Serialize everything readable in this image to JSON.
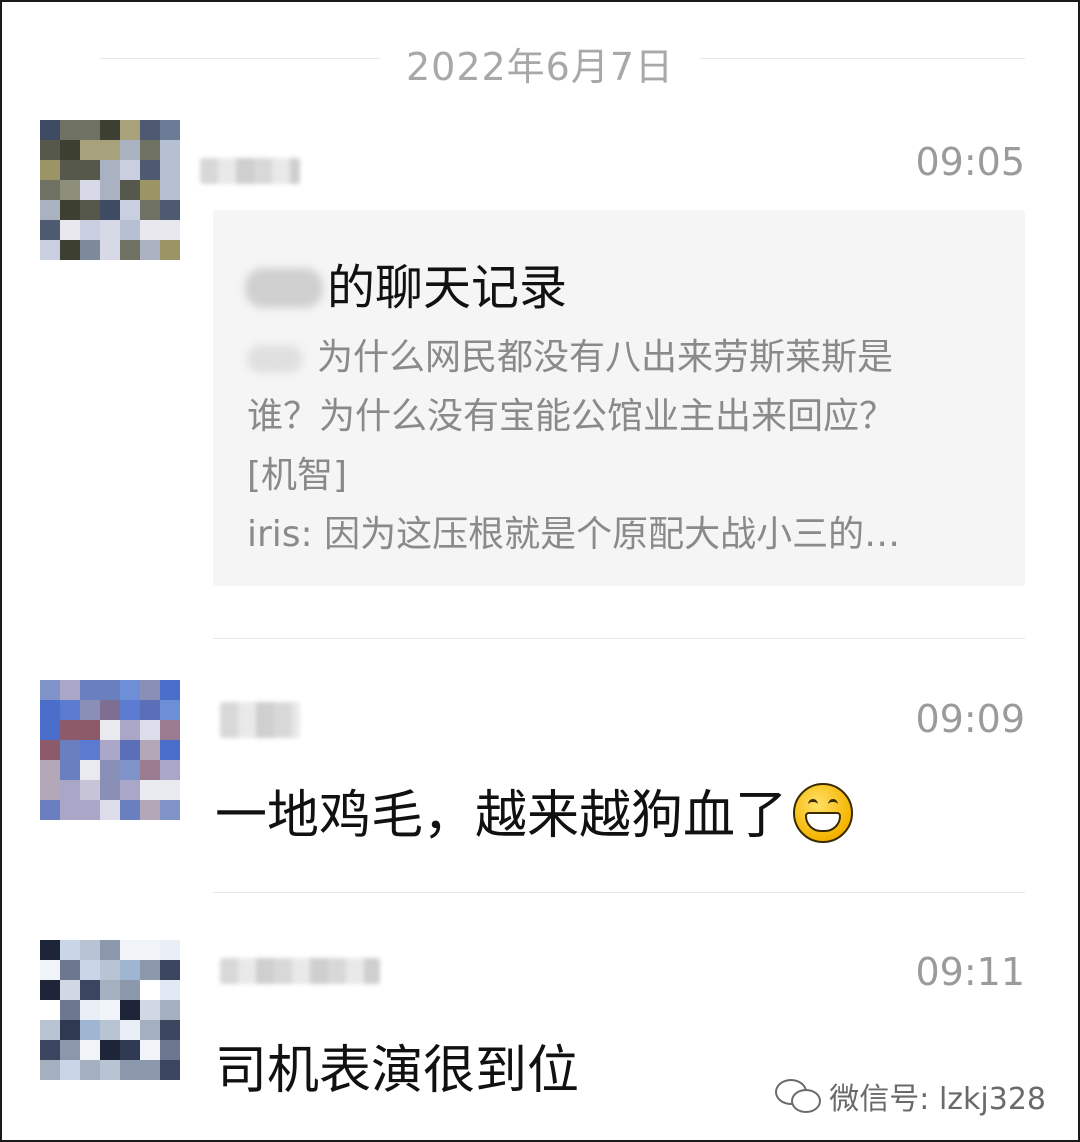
{
  "date_divider": "2022年6月7日",
  "messages": [
    {
      "time": "09:05",
      "type": "chat-record-card",
      "card": {
        "title_suffix": "的聊天记录",
        "lines": [
          "为什么网民都没有八出来劳斯莱斯是",
          "谁？为什么没有宝能公馆业主出来回应？",
          "[机智]",
          "iris: 因为这压根就是个原配大战小三的…"
        ]
      }
    },
    {
      "time": "09:09",
      "type": "text",
      "text": "一地鸡毛，越来越狗血了"
    },
    {
      "time": "09:11",
      "type": "text",
      "text": "司机表演很到位"
    }
  ],
  "watermark": "微信号: lzkj328",
  "icons": {
    "emoji": "grinning-face-icon",
    "watermark_logo": "wechat-icon"
  },
  "colors": {
    "card_bg": "#f5f5f5",
    "meta_text": "#9b9b9b",
    "body_text": "#111111"
  }
}
